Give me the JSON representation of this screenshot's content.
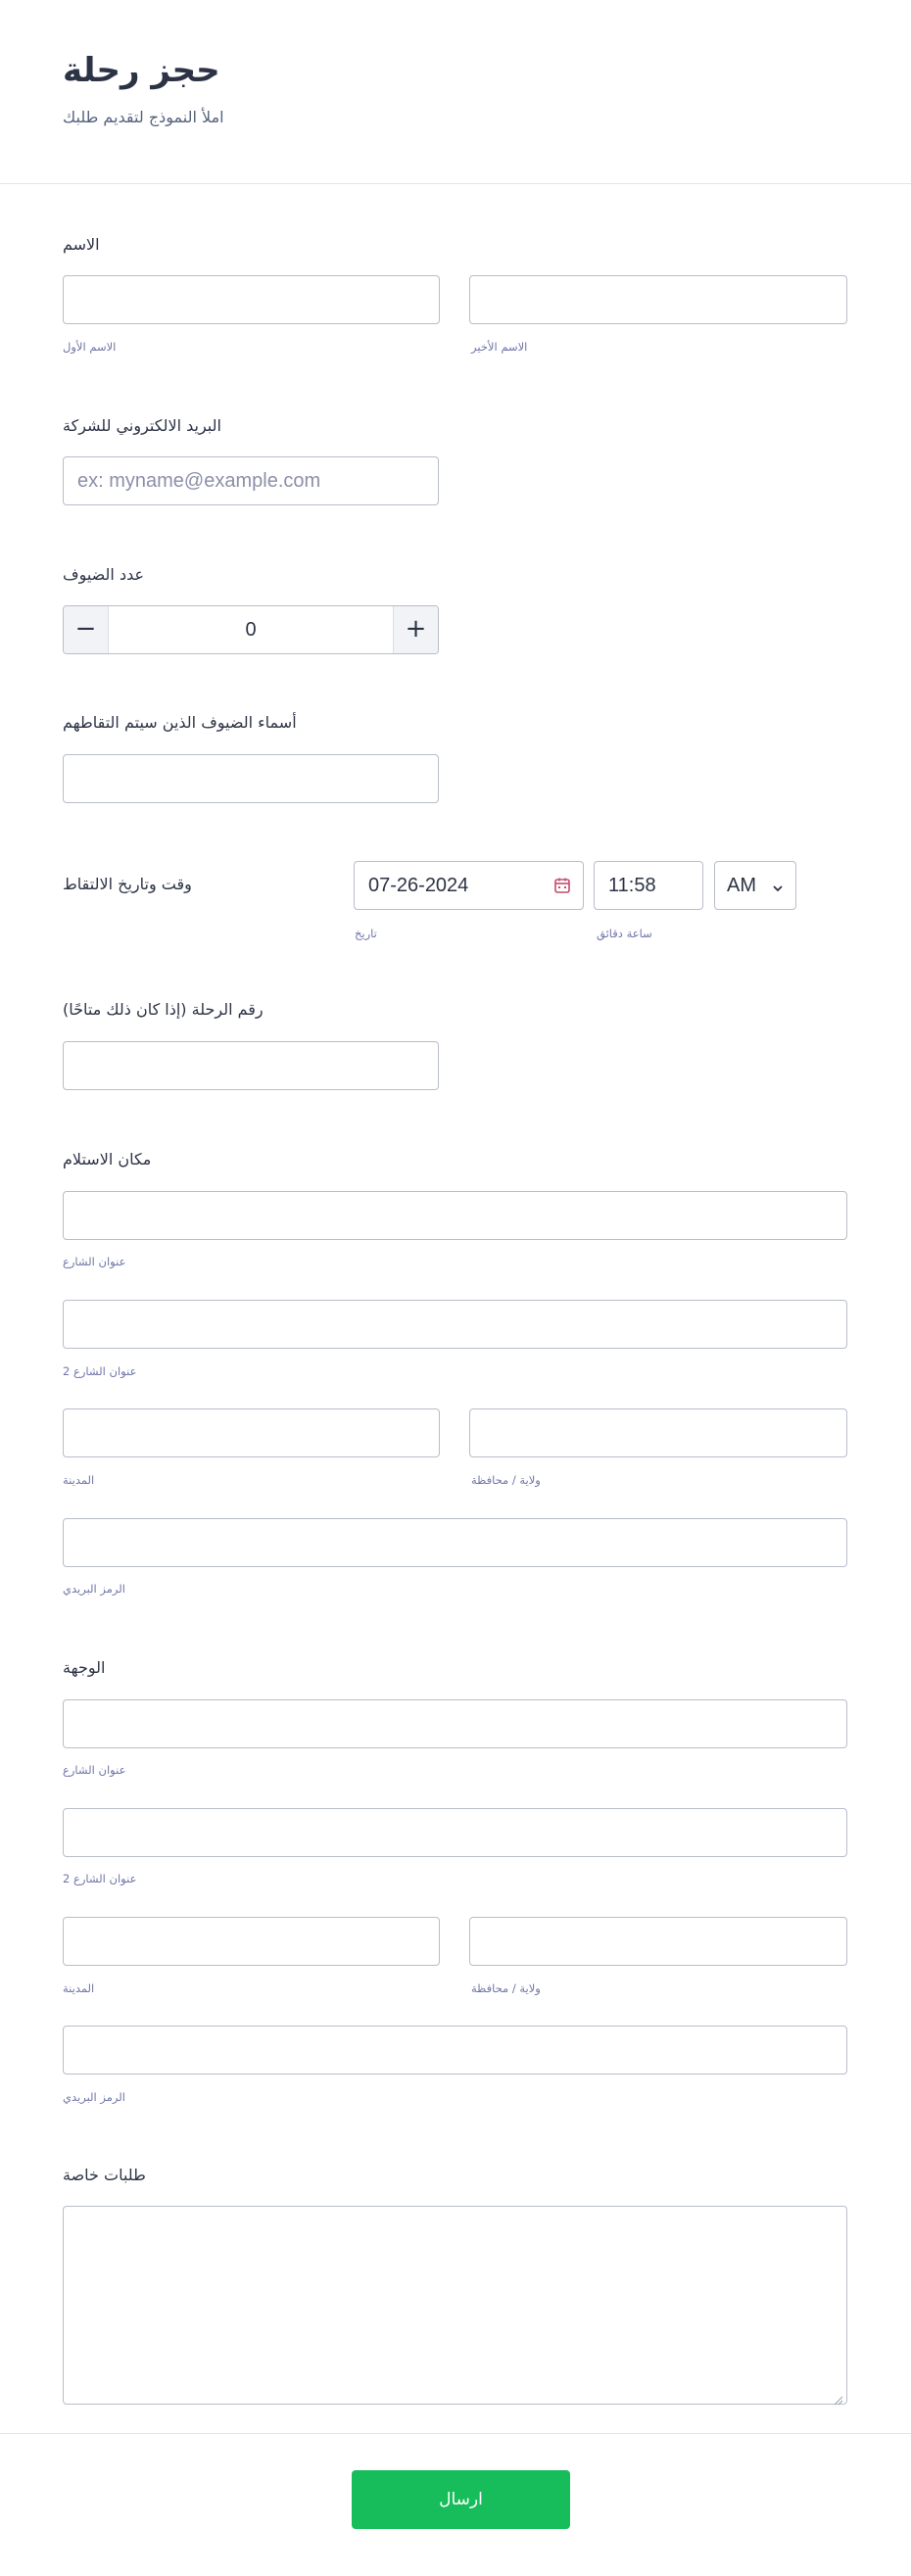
{
  "header": {
    "title": "حجز رحلة",
    "subtitle": "املأ النموذج لتقديم طلبك"
  },
  "name_field": {
    "label": "الاسم",
    "first_label": "الاسم الأول",
    "last_label": "الاسم الأخير",
    "first_value": "",
    "last_value": ""
  },
  "email_field": {
    "label": "البريد الالكتروني للشركة",
    "placeholder": "ex: myname@example.com",
    "value": ""
  },
  "guests_count": {
    "label": "عدد الضيوف",
    "value": "0",
    "minus": "−",
    "plus": "+"
  },
  "guest_names": {
    "label": "أسماء الضيوف الذين سيتم التقاطهم",
    "value": ""
  },
  "pickup_datetime": {
    "label": "وقت وتاريخ الالتقاط",
    "date_value": "07-26-2024",
    "date_label": "تاريخ",
    "time_value": "11:58",
    "time_label": "ساعة دقائق",
    "ampm_value": "AM"
  },
  "flight_number": {
    "label": "رقم الرحلة (إذا كان ذلك متاحًا)",
    "value": ""
  },
  "pickup_location": {
    "label": "مكان الاستلام",
    "street_label": "عنوان الشارع",
    "street2_label": "عنوان الشارع 2",
    "city_label": "المدينة",
    "state_label": "ولاية / محافظة",
    "zip_label": "الرمز البريدي"
  },
  "destination": {
    "label": "الوجهة",
    "street_label": "عنوان الشارع",
    "street2_label": "عنوان الشارع 2",
    "city_label": "المدينة",
    "state_label": "ولاية / محافظة",
    "zip_label": "الرمز البريدي"
  },
  "special_requests": {
    "label": "طلبات خاصة",
    "value": ""
  },
  "submit": {
    "label": "ارسال",
    "color": "#18bd5b"
  },
  "icons": {
    "calendar": "calendar-icon",
    "chevron": "chevron-down-icon"
  }
}
